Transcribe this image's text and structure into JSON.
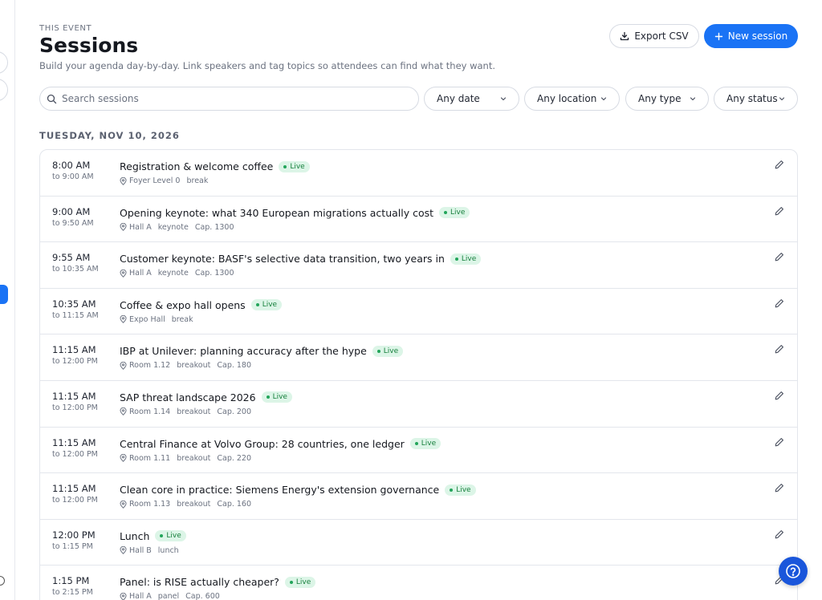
{
  "header": {
    "eyebrow": "THIS EVENT",
    "title": "Sessions",
    "subtitle": "Build your agenda day-by-day. Link speakers and tag topics so attendees can find what they want."
  },
  "actions": {
    "export_label": "Export CSV",
    "new_label": "New session"
  },
  "search": {
    "placeholder": "Search sessions",
    "value": ""
  },
  "filters": {
    "date": "Any date",
    "location": "Any location",
    "type": "Any type",
    "status": "Any status"
  },
  "day_heading": "TUESDAY, NOV 10, 2026",
  "sessions": [
    {
      "start": "8:00 AM",
      "end": "to 9:00 AM",
      "title": "Registration & welcome coffee",
      "status": "Live",
      "location": "Foyer Level 0",
      "type": "break",
      "capacity": ""
    },
    {
      "start": "9:00 AM",
      "end": "to 9:50 AM",
      "title": "Opening keynote: what 340 European migrations actually cost",
      "status": "Live",
      "location": "Hall A",
      "type": "keynote",
      "capacity": "Cap. 1300"
    },
    {
      "start": "9:55 AM",
      "end": "to 10:35 AM",
      "title": "Customer keynote: BASF's selective data transition, two years in",
      "status": "Live",
      "location": "Hall A",
      "type": "keynote",
      "capacity": "Cap. 1300"
    },
    {
      "start": "10:35 AM",
      "end": "to 11:15 AM",
      "title": "Coffee & expo hall opens",
      "status": "Live",
      "location": "Expo Hall",
      "type": "break",
      "capacity": ""
    },
    {
      "start": "11:15 AM",
      "end": "to 12:00 PM",
      "title": "IBP at Unilever: planning accuracy after the hype",
      "status": "Live",
      "location": "Room 1.12",
      "type": "breakout",
      "capacity": "Cap. 180"
    },
    {
      "start": "11:15 AM",
      "end": "to 12:00 PM",
      "title": "SAP threat landscape 2026",
      "status": "Live",
      "location": "Room 1.14",
      "type": "breakout",
      "capacity": "Cap. 200"
    },
    {
      "start": "11:15 AM",
      "end": "to 12:00 PM",
      "title": "Central Finance at Volvo Group: 28 countries, one ledger",
      "status": "Live",
      "location": "Room 1.11",
      "type": "breakout",
      "capacity": "Cap. 220"
    },
    {
      "start": "11:15 AM",
      "end": "to 12:00 PM",
      "title": "Clean core in practice: Siemens Energy's extension governance",
      "status": "Live",
      "location": "Room 1.13",
      "type": "breakout",
      "capacity": "Cap. 160"
    },
    {
      "start": "12:00 PM",
      "end": "to 1:15 PM",
      "title": "Lunch",
      "status": "Live",
      "location": "Hall B",
      "type": "lunch",
      "capacity": ""
    },
    {
      "start": "1:15 PM",
      "end": "to 2:15 PM",
      "title": "Panel: is RISE actually cheaper?",
      "status": "Live",
      "location": "Hall A",
      "type": "panel",
      "capacity": "Cap. 600"
    }
  ],
  "colors": {
    "accent": "#1a73f5",
    "live_bg": "#dcf5e7",
    "live_text": "#17803d"
  },
  "icons": {
    "export": "download-icon",
    "new": "plus-icon",
    "search": "search-icon",
    "filter": "chevron-down-icon",
    "location": "map-pin-icon",
    "edit": "pencil-icon",
    "help": "help-circle-icon"
  }
}
